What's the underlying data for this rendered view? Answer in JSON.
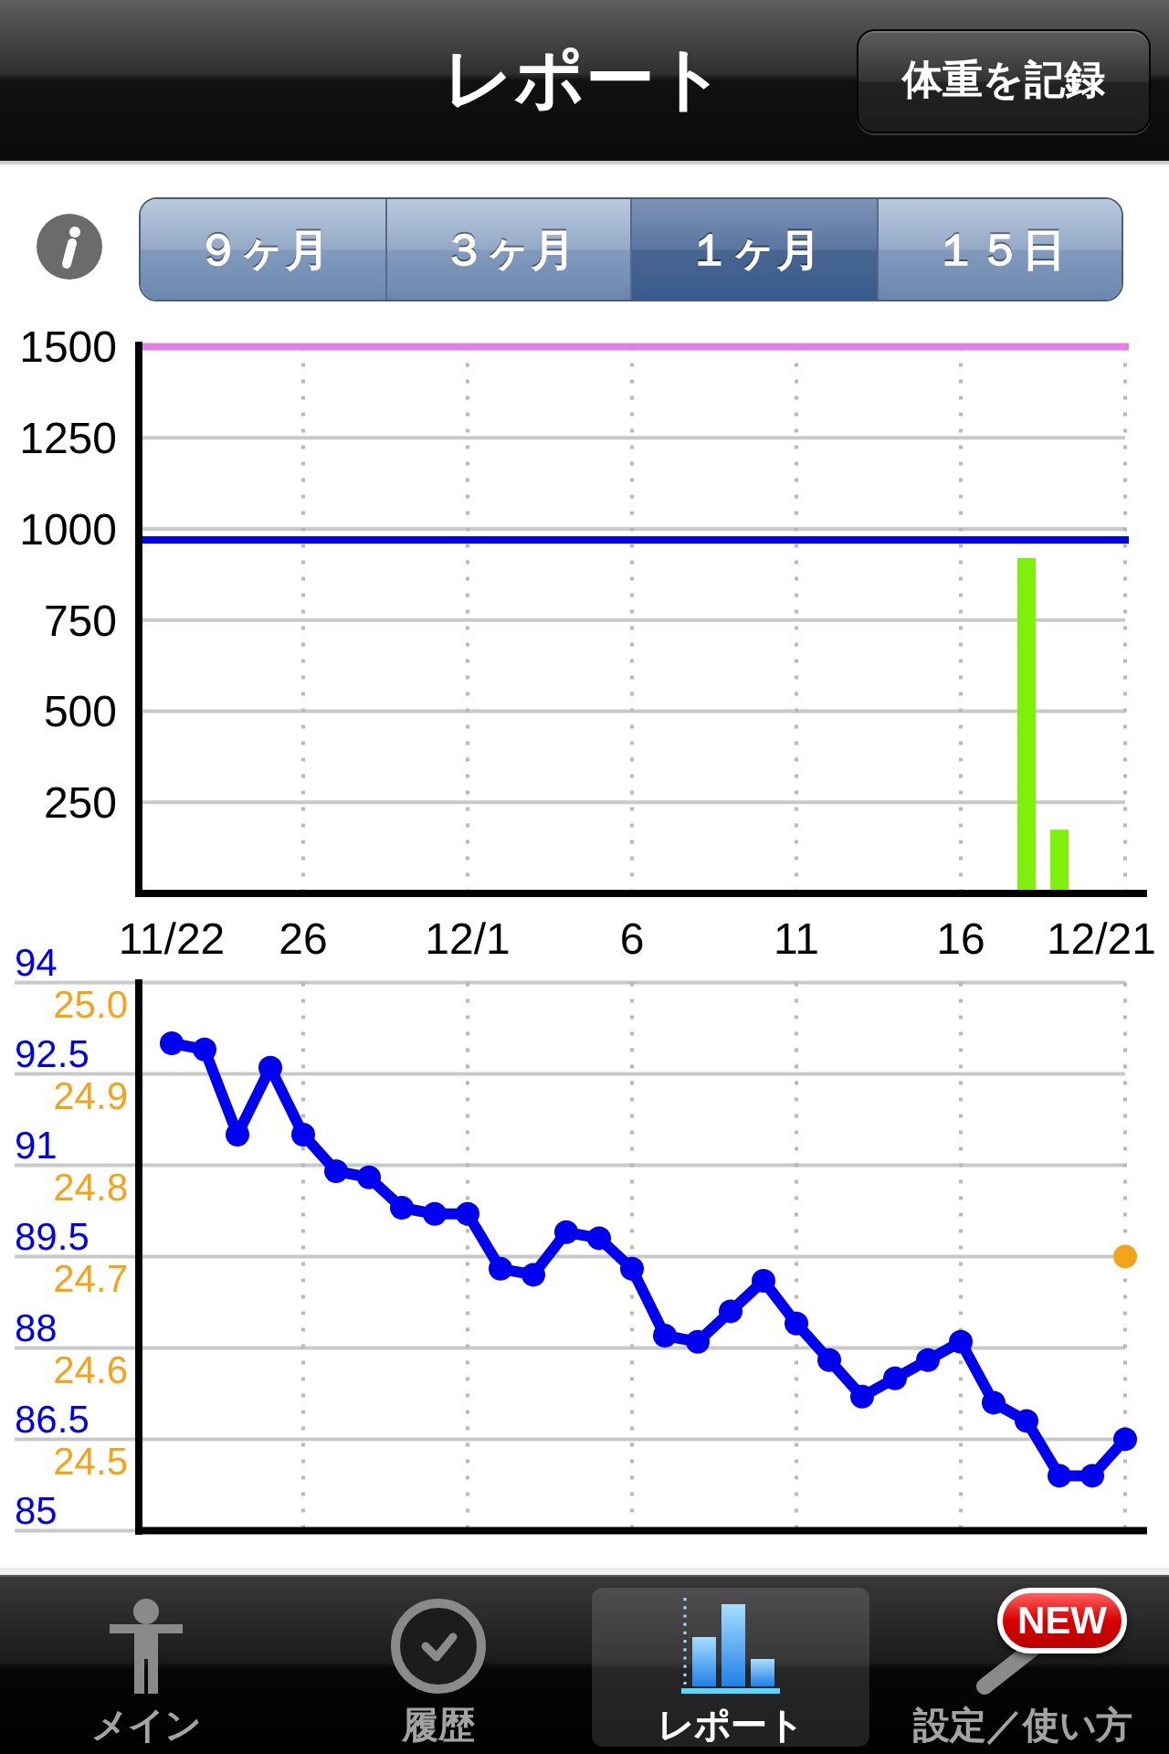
{
  "nav_bar": {
    "title": "レポート",
    "record_button": "体重を記録"
  },
  "period_selector": {
    "segments": [
      {
        "label": "９ヶ月",
        "selected": false
      },
      {
        "label": "３ヶ月",
        "selected": false
      },
      {
        "label": "１ヶ月",
        "selected": true
      },
      {
        "label": "１５日",
        "selected": false
      }
    ]
  },
  "bar_chart": {
    "chart_data": {
      "type": "bar",
      "categories": [
        "11/22",
        null,
        null,
        null,
        "26",
        null,
        null,
        null,
        null,
        "12/1",
        null,
        null,
        null,
        null,
        "6",
        null,
        null,
        null,
        null,
        "11",
        null,
        null,
        null,
        null,
        "16",
        null,
        null,
        null,
        null,
        "12/21"
      ],
      "ylim": [
        0,
        1500
      ],
      "grid": true,
      "yticks": [
        250,
        500,
        750,
        1000,
        1250,
        1500
      ],
      "series": [
        {
          "color": "#7ef00c",
          "values": [
            null,
            null,
            null,
            null,
            null,
            null,
            null,
            null,
            null,
            null,
            null,
            null,
            null,
            null,
            null,
            null,
            null,
            null,
            null,
            null,
            null,
            null,
            null,
            null,
            null,
            null,
            920,
            175,
            null,
            null
          ]
        }
      ],
      "ref_lines": [
        {
          "axis": "y",
          "value": 1500,
          "color": "#e27ee6"
        },
        {
          "axis": "y",
          "value": 970,
          "color": "#0000f0"
        }
      ]
    }
  },
  "line_chart": {
    "chart_data": {
      "type": "line",
      "ylim": [
        85,
        94
      ],
      "grid": true,
      "yticks": [
        94,
        92.5,
        91,
        89.5,
        88,
        86.5,
        85
      ],
      "y2lim": [
        24.4,
        25.0
      ],
      "y2ticks": [
        {
          "value": 25,
          "label": "25.0"
        },
        24.9,
        24.8,
        24.7,
        24.6,
        24.5
      ],
      "series": [
        {
          "color": "#0000f0",
          "marker": "circle",
          "values": [
            93.0,
            92.9,
            91.5,
            92.6,
            91.5,
            90.9,
            90.8,
            90.3,
            90.2,
            90.2,
            89.3,
            89.2,
            89.9,
            89.8,
            89.3,
            88.2,
            88.1,
            88.6,
            89.1,
            88.4,
            87.8,
            87.2,
            87.5,
            87.8,
            88.1,
            87.1,
            86.8,
            85.9,
            85.9,
            86.5
          ]
        },
        {
          "color": "#f5a31a",
          "axis": "y2",
          "marker": "circle",
          "values": [
            null,
            null,
            null,
            null,
            null,
            null,
            null,
            null,
            null,
            null,
            null,
            null,
            null,
            null,
            null,
            null,
            null,
            null,
            null,
            null,
            null,
            null,
            null,
            null,
            null,
            null,
            null,
            null,
            null,
            24.7
          ]
        }
      ]
    }
  },
  "tab_bar": {
    "items": [
      {
        "label": "メイン",
        "selected": false
      },
      {
        "label": "履歴",
        "selected": false
      },
      {
        "label": "レポート",
        "selected": true
      },
      {
        "label": "設定／使い方",
        "selected": false,
        "badge": "NEW"
      }
    ]
  }
}
